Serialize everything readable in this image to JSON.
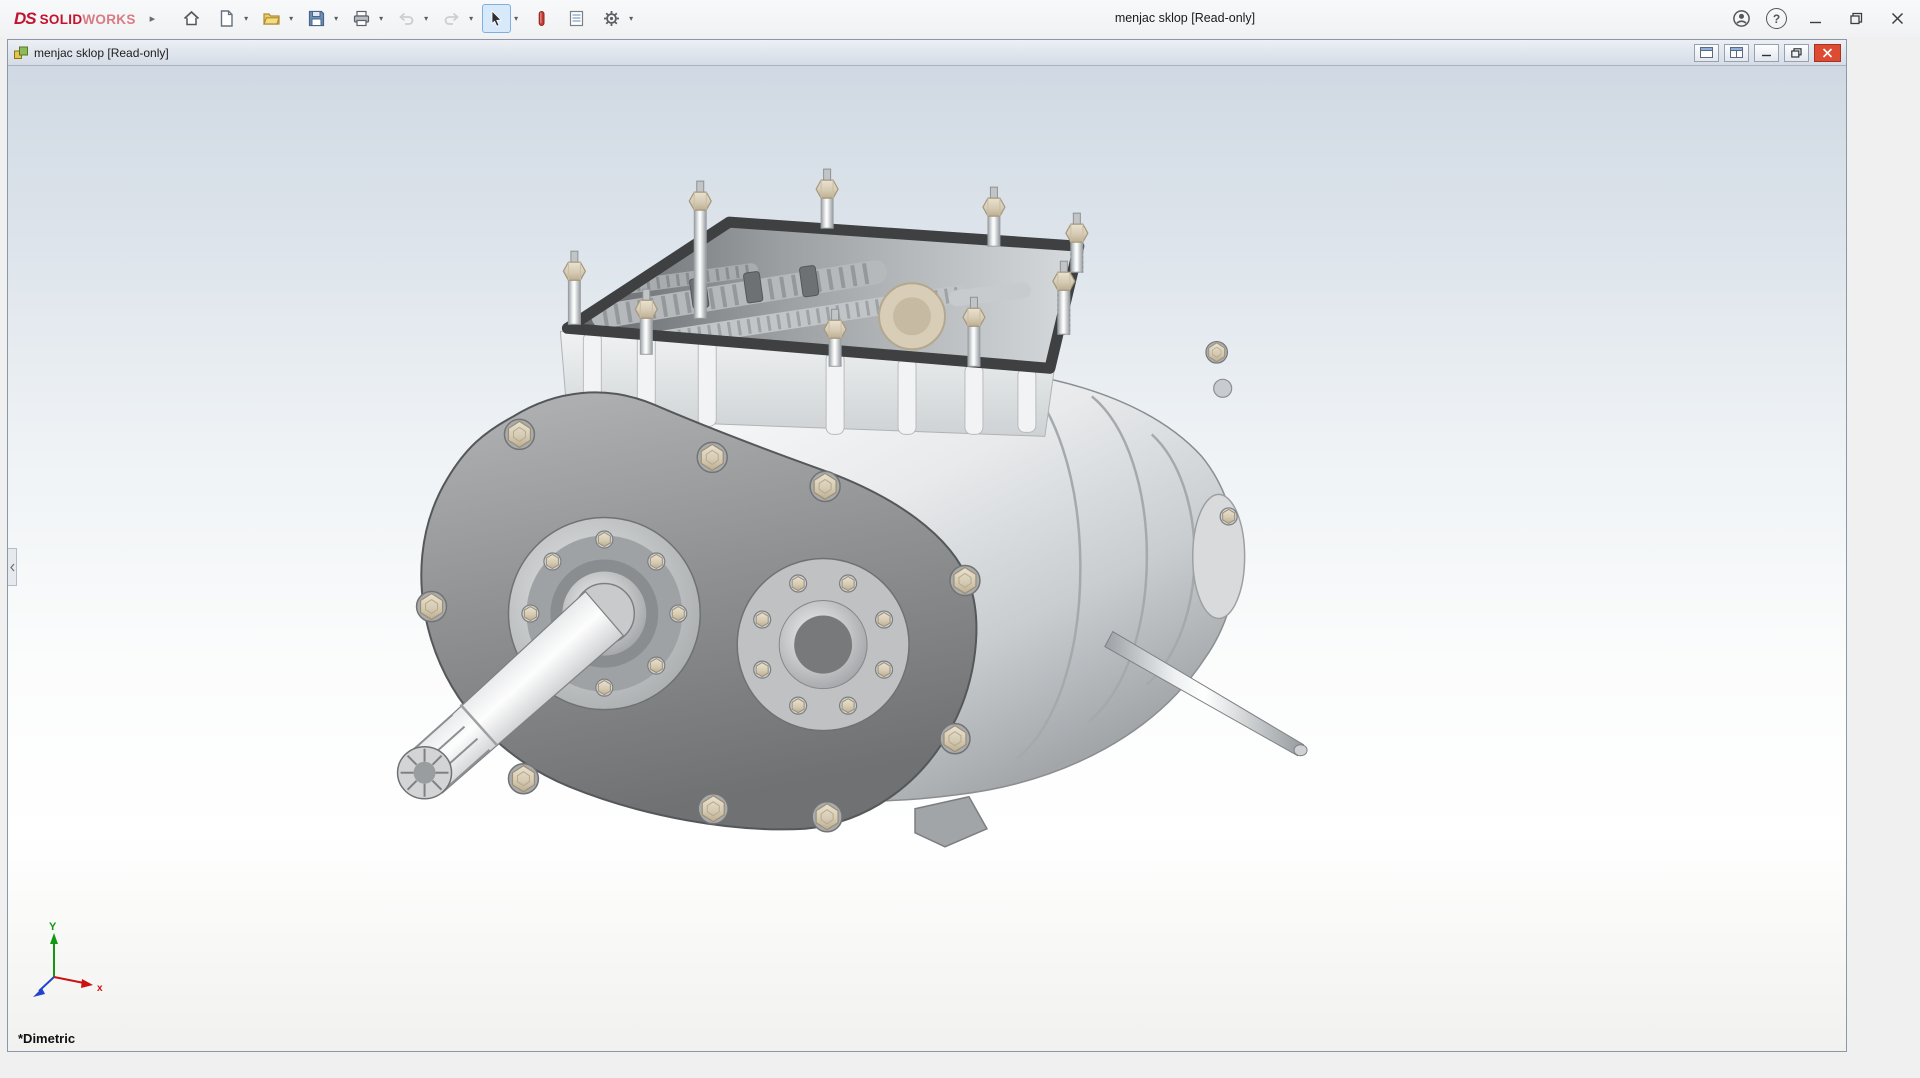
{
  "app": {
    "brand": {
      "prefix": "DS",
      "bold": "SOLID",
      "light": "WORKS"
    },
    "window_title": "menjac sklop [Read-only]",
    "nav_expand_glyph": "▸",
    "dropdown_glyph": "▾",
    "help_glyph": "?"
  },
  "doc": {
    "title": "menjac sklop [Read-only]"
  },
  "viewport": {
    "orientation_label": "*Dimetric",
    "triad": {
      "x": "x",
      "y": "Y"
    }
  },
  "icons": {
    "home": "house",
    "new_document": "page",
    "open": "folder",
    "save": "floppy-disk",
    "print": "printer",
    "undo": "curved-arrow-left",
    "redo": "curved-arrow-right",
    "select": "cursor-arrow",
    "rebuild": "red-capsule",
    "file_properties": "document-table",
    "options": "gear",
    "account": "person-circle",
    "help": "question-mark",
    "minimize": "line",
    "maximize": "square",
    "close": "x",
    "doc_tile_a": "pane-window",
    "doc_tile_b": "pane-window",
    "doc_minimize": "line",
    "doc_restore": "overlapping-squares",
    "doc_close": "x",
    "assembly_document": "assembly-blocks",
    "featuremanager_handle": "chevron-left"
  },
  "colors": {
    "brand_red": "#c4112f",
    "accent_select_bg": "#d8e9f9",
    "accent_select_border": "#7fb0e0",
    "close_red": "#dd4b33",
    "viewport_top": "#d0d9e3",
    "bolt_beige": "#d6cbb4",
    "plate_gray": "#8f9193",
    "gasket_dark": "#3e4042",
    "triad_x": "#cc1111",
    "triad_y": "#119911",
    "triad_z": "#2244cc"
  }
}
